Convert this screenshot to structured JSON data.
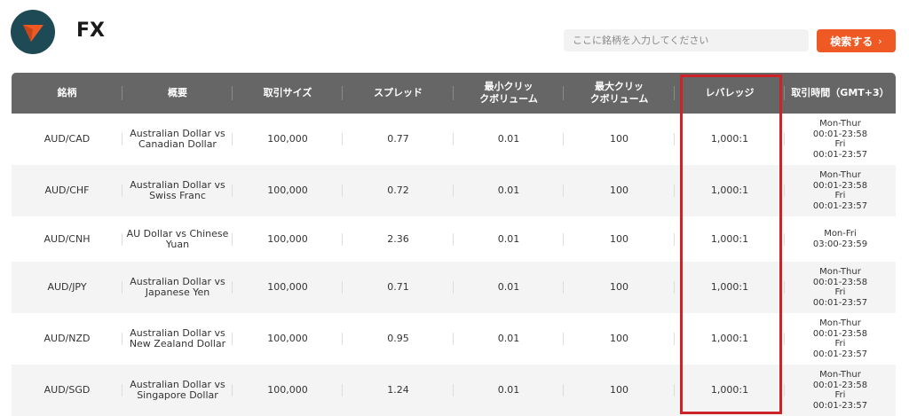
{
  "header": {
    "title": "FX",
    "search_placeholder": "ここに銘柄を入力してください",
    "search_button_label": "検索する",
    "search_button_chevron": "›"
  },
  "colors": {
    "logo_bg": "#1d4a55",
    "logo_mark": "#ef5a24",
    "accent": "#ef5a24",
    "table_header_bg": "#666666",
    "highlight_border": "#cc2229"
  },
  "icons": {
    "logo": "triangle-arrow-logo-icon",
    "search_chevron": "chevron-right-icon"
  },
  "table": {
    "columns": [
      "銘柄",
      "概要",
      "取引サイズ",
      "スプレッド",
      "最小クリッ\nクボリューム",
      "最大クリッ\nクボリューム",
      "レバレッジ",
      "取引時間（GMT+3）"
    ],
    "rows": [
      {
        "symbol": "AUD/CAD",
        "description": "Australian Dollar vs\nCanadian Dollar",
        "trade_size": "100,000",
        "spread": "0.77",
        "min_volume": "0.01",
        "max_volume": "100",
        "leverage": "1,000:1",
        "hours": "Mon-Thur\n00:01-23:58\nFri\n00:01-23:57",
        "height": 58
      },
      {
        "symbol": "AUD/CHF",
        "description": "Australian Dollar vs\nSwiss Franc",
        "trade_size": "100,000",
        "spread": "0.72",
        "min_volume": "0.01",
        "max_volume": "100",
        "leverage": "1,000:1",
        "hours": "Mon-Thur\n00:01-23:58\nFri\n00:01-23:57",
        "height": 58
      },
      {
        "symbol": "AUD/CNH",
        "description": "AU Dollar vs Chinese\nYuan",
        "trade_size": "100,000",
        "spread": "2.36",
        "min_volume": "0.01",
        "max_volume": "100",
        "leverage": "1,000:1",
        "hours": "Mon-Fri\n03:00-23:59",
        "height": 51
      },
      {
        "symbol": "AUD/JPY",
        "description": "Australian Dollar vs\nJapanese Yen",
        "trade_size": "100,000",
        "spread": "0.71",
        "min_volume": "0.01",
        "max_volume": "100",
        "leverage": "1,000:1",
        "hours": "Mon-Thur\n00:01-23:58\nFri\n00:01-23:57",
        "height": 58
      },
      {
        "symbol": "AUD/NZD",
        "description": "Australian Dollar vs\nNew Zealand Dollar",
        "trade_size": "100,000",
        "spread": "0.95",
        "min_volume": "0.01",
        "max_volume": "100",
        "leverage": "1,000:1",
        "hours": "Mon-Thur\n00:01-23:58\nFri\n00:01-23:57",
        "height": 58
      },
      {
        "symbol": "AUD/SGD",
        "description": "Australian Dollar vs\nSingapore Dollar",
        "trade_size": "100,000",
        "spread": "1.24",
        "min_volume": "0.01",
        "max_volume": "100",
        "leverage": "1,000:1",
        "hours": "Mon-Thur\n00:01-23:58\nFri\n00:01-23:57",
        "height": 58
      }
    ]
  }
}
